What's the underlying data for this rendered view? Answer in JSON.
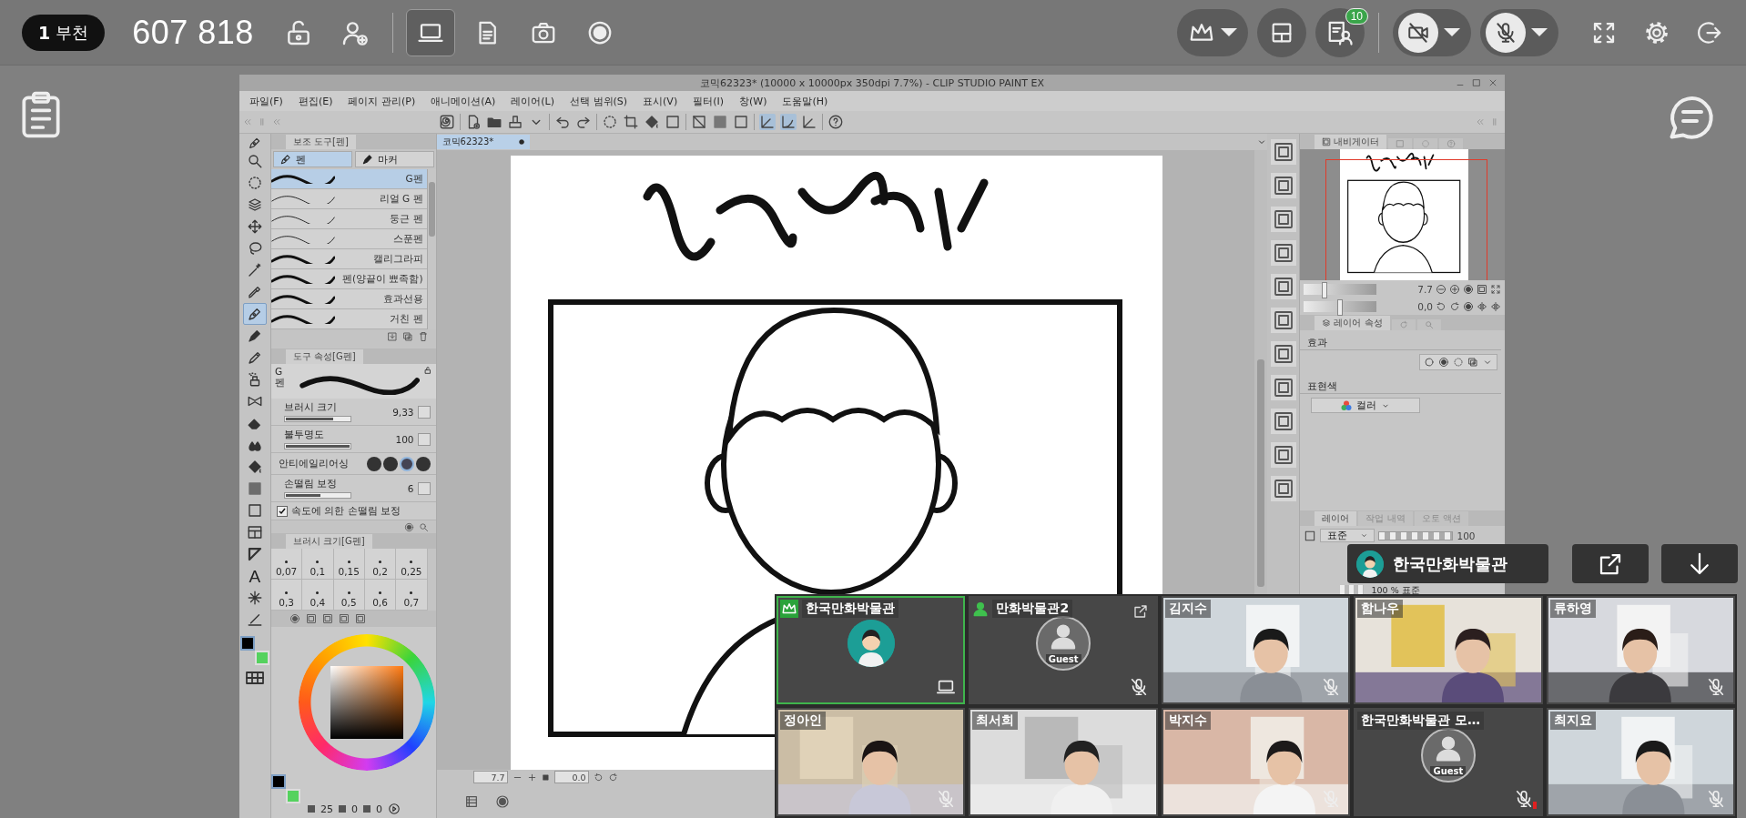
{
  "top_bar": {
    "room": {
      "number": "1",
      "name": "부천"
    },
    "meeting_number": "607 818",
    "share_modes": [
      {
        "selected": true
      },
      {
        "selected": false
      },
      {
        "selected": false
      },
      {
        "selected": false
      }
    ],
    "participant_count": "10",
    "camera": {
      "on": false
    },
    "microphone": {
      "on": false
    }
  },
  "csp": {
    "title": "코믹62323* (10000 x 10000px 350dpi 7.7%)  - CLIP STUDIO PAINT EX",
    "menu": [
      "파일(F)",
      "편집(E)",
      "페이지 관리(P)",
      "애니메이션(A)",
      "레이어(L)",
      "선택 범위(S)",
      "표시(V)",
      "필터(I)",
      "창(W)",
      "도움말(H)"
    ],
    "document_tab": "코믹62323*",
    "tools": [
      {
        "selected": false
      },
      {
        "selected": false
      },
      {
        "selected": false
      },
      {
        "selected": false
      },
      {
        "selected": false
      },
      {
        "selected": false
      },
      {
        "selected": false
      },
      {
        "selected": true
      },
      {
        "selected": false
      },
      {
        "selected": false
      },
      {
        "selected": false
      },
      {
        "selected": false
      },
      {
        "selected": false
      },
      {
        "selected": false
      },
      {
        "selected": false
      },
      {
        "selected": false
      },
      {
        "selected": false
      },
      {
        "selected": false
      },
      {
        "selected": false
      },
      {
        "selected": false,
        "glyph": "A"
      },
      {
        "selected": false
      },
      {
        "selected": false
      }
    ],
    "tool_colors": [
      {
        "color": "#000000",
        "selected": true
      },
      {
        "color": "#55d25e",
        "selected": false
      }
    ],
    "sub_tool": {
      "title": "보조 도구[펜]",
      "groups": [
        {
          "label": "펜",
          "selected": true
        },
        {
          "label": "마커",
          "selected": false
        }
      ],
      "brushes": [
        {
          "name": "G펜",
          "selected": true
        },
        {
          "name": "리얼 G 펜",
          "selected": false
        },
        {
          "name": "둥근 펜",
          "selected": false
        },
        {
          "name": "스푼펜",
          "selected": false
        },
        {
          "name": "캘리그라피",
          "selected": false
        },
        {
          "name": "펜(양끝이 뾰족함)",
          "selected": false
        },
        {
          "name": "효과선용",
          "selected": false
        },
        {
          "name": "거친 펜",
          "selected": false
        }
      ]
    },
    "tool_property": {
      "title": "도구 속성[G펜]",
      "brush": "G펜",
      "settings": [
        {
          "kind": "slider",
          "label": "브러시 크기",
          "value": "9,33",
          "level": 0.75
        },
        {
          "kind": "slider",
          "label": "불투명도",
          "value": "100",
          "level": 1
        },
        {
          "kind": "swatches",
          "label": "안티에일리어싱",
          "options": [
            {
              "selected": false
            },
            {
              "selected": false
            },
            {
              "selected": true
            },
            {
              "selected": false
            }
          ]
        },
        {
          "kind": "slider",
          "label": "손떨림 보정",
          "value": "6",
          "level": 0.55
        },
        {
          "kind": "checkbox",
          "label": "속도에 의한 손떨림 보정",
          "checked": true
        }
      ]
    },
    "brush_size": {
      "title": "브러시 크기[G펜]",
      "sizes": [
        "0,07",
        "0,1",
        "0,15",
        "0,2",
        "0,25",
        "0,3",
        "0,4",
        "0,5",
        "0,6",
        "0,7"
      ]
    },
    "color": {
      "swatches": [
        {
          "color": "#000000",
          "selected": true
        },
        {
          "color": "#55d25e",
          "selected": false
        }
      ],
      "readouts": [
        "25",
        "0",
        "0"
      ]
    },
    "canvas_status": {
      "zoom": "7.7",
      "angle": "0.0"
    },
    "navigator": {
      "title": "내비게이터",
      "zoom": "7.7",
      "zoom_slider": {
        "level": 0.28
      },
      "angle": "0,0",
      "angle_slider": {
        "level": 0.5
      }
    },
    "layer_property": {
      "title": "레이어 속성",
      "effect_label": "효과",
      "color_label": "표현색",
      "color_mode": "컬러"
    },
    "layers": {
      "tabs": [
        {
          "label": "레이어",
          "selected": true
        },
        {
          "label": "작업 내역",
          "selected": false
        },
        {
          "label": "오토 액션",
          "selected": false
        }
      ],
      "blend": "표준",
      "opacity": "100",
      "layer_row": "100 % 표준"
    }
  },
  "presenter": {
    "name": "한국만화박물관"
  },
  "participants": [
    {
      "name": "한국만화박물관",
      "kind": "avatar",
      "host": true,
      "active": true,
      "muted": false,
      "presenting": true
    },
    {
      "name": "만화박물관2",
      "kind": "guest",
      "avatar_label": "Guest",
      "signed_in": true,
      "active": false,
      "muted": true,
      "sharing": true
    },
    {
      "name": "김지수",
      "kind": "camera",
      "active": false,
      "muted": true
    },
    {
      "name": "함나우",
      "kind": "camera",
      "active": false,
      "muted": false
    },
    {
      "name": "류하영",
      "kind": "camera",
      "active": false,
      "muted": true
    },
    {
      "name": "정아인",
      "kind": "camera",
      "active": false,
      "muted": true
    },
    {
      "name": "최서희",
      "kind": "camera",
      "active": false,
      "muted": false
    },
    {
      "name": "박지수",
      "kind": "camera",
      "active": false,
      "muted": true
    },
    {
      "name": "한국만화박물관 모…",
      "kind": "guest",
      "avatar_label": "Guest",
      "active": false,
      "muted": true,
      "alert": true
    },
    {
      "name": "최지요",
      "kind": "camera",
      "active": false,
      "muted": true
    }
  ]
}
